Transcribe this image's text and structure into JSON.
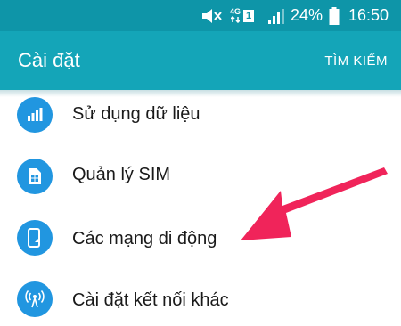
{
  "status_bar": {
    "network_label": "4G",
    "sim_slot": "1",
    "battery_percent": "24%",
    "time": "16:50"
  },
  "app_bar": {
    "title": "Cài đặt",
    "search_label": "TÌM KIẾM"
  },
  "settings_list": [
    {
      "label": "Sử dụng dữ liệu",
      "icon": "data-usage-icon"
    },
    {
      "label": "Quản lý SIM",
      "icon": "sim-card-icon"
    },
    {
      "label": "Các mạng di động",
      "icon": "mobile-network-icon"
    },
    {
      "label": "Cài đặt kết nối khác",
      "icon": "connection-icon"
    }
  ],
  "colors": {
    "status_bar_bg": "#0e95a8",
    "app_bar_bg": "#14a5b8",
    "icon_circle": "#2196e0",
    "annotation_arrow": "#f0245a"
  }
}
